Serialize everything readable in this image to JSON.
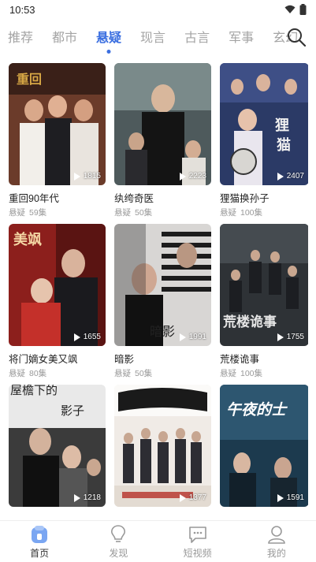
{
  "status_bar": {
    "time": "10:53"
  },
  "tabs": [
    {
      "label": "推荐"
    },
    {
      "label": "都市"
    },
    {
      "label": "悬疑"
    },
    {
      "label": "现言"
    },
    {
      "label": "古言"
    },
    {
      "label": "军事"
    },
    {
      "label": "玄幻"
    }
  ],
  "active_tab_index": 2,
  "cards": [
    {
      "title": "重回90年代",
      "genre": "悬疑",
      "episodes": "59集",
      "plays": "1815"
    },
    {
      "title": "纨绔奇医",
      "genre": "悬疑",
      "episodes": "50集",
      "plays": "2223"
    },
    {
      "title": "狸猫换孙子",
      "genre": "悬疑",
      "episodes": "100集",
      "plays": "2407"
    },
    {
      "title": "将门嫡女美又飒",
      "genre": "悬疑",
      "episodes": "80集",
      "plays": "1655"
    },
    {
      "title": "暗影",
      "genre": "悬疑",
      "episodes": "50集",
      "plays": "1991"
    },
    {
      "title": "荒楼诡事",
      "genre": "悬疑",
      "episodes": "100集",
      "plays": "1755"
    },
    {
      "title": "",
      "genre": "",
      "episodes": "",
      "plays": "1218"
    },
    {
      "title": "",
      "genre": "",
      "episodes": "",
      "plays": "1377"
    },
    {
      "title": "",
      "genre": "",
      "episodes": "",
      "plays": "1591"
    }
  ],
  "poster_texts": {
    "card4": "美飒",
    "card5": "暗影",
    "card6": "荒楼诡事",
    "card7_line1": "屋檐下的",
    "card7_line2": "影子",
    "card9": "午夜的士"
  },
  "bottom_nav": [
    {
      "label": "首页",
      "icon": "home-icon"
    },
    {
      "label": "发现",
      "icon": "bulb-icon"
    },
    {
      "label": "短视频",
      "icon": "chat-video-icon"
    },
    {
      "label": "我的",
      "icon": "user-icon"
    }
  ],
  "colors": {
    "accent": "#3b6fe0",
    "inactive": "#a4a4a4",
    "meta": "#999999"
  }
}
